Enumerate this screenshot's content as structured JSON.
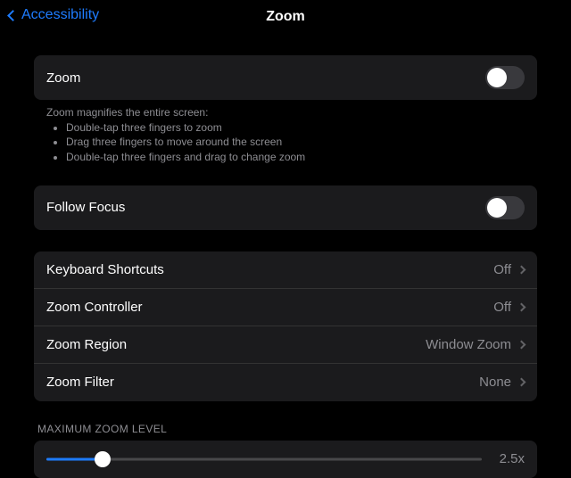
{
  "header": {
    "back": "Accessibility",
    "title": "Zoom"
  },
  "zoom_toggle": {
    "label": "Zoom"
  },
  "help": {
    "intro": "Zoom magnifies the entire screen:",
    "items": [
      "Double-tap three fingers to zoom",
      "Drag three fingers to move around the screen",
      "Double-tap three fingers and drag to change zoom"
    ]
  },
  "follow_focus": {
    "label": "Follow Focus"
  },
  "options": [
    {
      "label": "Keyboard Shortcuts",
      "value": "Off"
    },
    {
      "label": "Zoom Controller",
      "value": "Off"
    },
    {
      "label": "Zoom Region",
      "value": "Window Zoom"
    },
    {
      "label": "Zoom Filter",
      "value": "None"
    }
  ],
  "slider": {
    "header": "MAXIMUM ZOOM LEVEL",
    "value": "2.5x"
  }
}
